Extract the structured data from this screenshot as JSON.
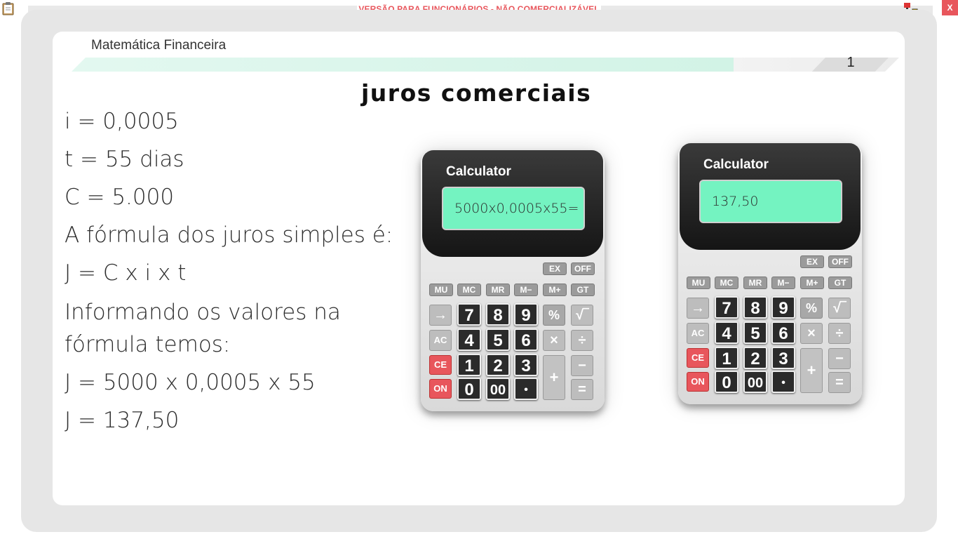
{
  "window": {
    "watermark": "VERSÃO PARA FUNCIONÁRIOS - NÃO COMERCIALIZÁVEL",
    "close_label": "X"
  },
  "slide": {
    "course": "Matemática Financeira",
    "page_number": "1",
    "title": "juros comerciais",
    "lines": [
      "i = 0,0005",
      "t = 55 dias",
      "C = 5.000",
      "A fórmula dos juros simples é:",
      "J = C x i x t",
      "Informando os valores na fórmula temos:",
      "J = 5000 x 0,0005 x 55",
      "J = 137,50"
    ]
  },
  "calculators": [
    {
      "brand": "Calculator",
      "display": "5000x0,0005x55="
    },
    {
      "brand": "Calculator",
      "display": "137,50"
    }
  ],
  "keys": {
    "ex": "EX",
    "off": "OFF",
    "mu": "MU",
    "mc": "MC",
    "mr": "MR",
    "mminus": "M−",
    "mplus": "M+",
    "gt": "GT",
    "arrow": "→",
    "k7": "7",
    "k8": "8",
    "k9": "9",
    "pct": "%",
    "sqrt": "√‾",
    "ac": "AC",
    "k4": "4",
    "k5": "5",
    "k6": "6",
    "mul": "×",
    "div": "÷",
    "ce": "CE",
    "k1": "1",
    "k2": "2",
    "k3": "3",
    "plus": "+",
    "minus": "−",
    "on": "ON",
    "k0": "0",
    "k00": "00",
    "dot": "•",
    "eq": "="
  },
  "colors": {
    "accent_red": "#e8565c",
    "screen_green": "#74f3c1",
    "header_bar": "#d6f5ea"
  }
}
